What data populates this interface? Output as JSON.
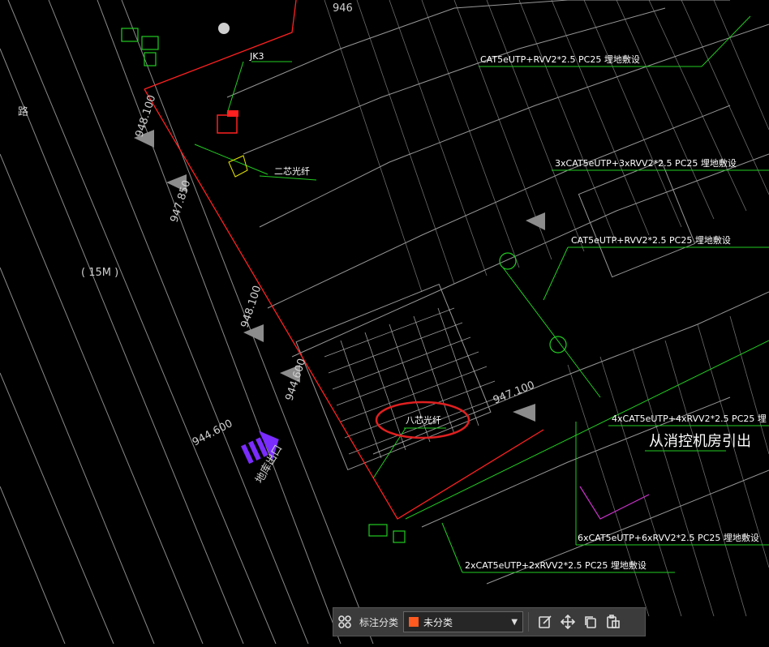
{
  "drawing": {
    "labels": {
      "jk": "JK3",
      "fiber2": "二芯光纤",
      "fiber8": "八芯光纤",
      "cable1": "CAT5eUTP+RVV2*2.5  PC25  埋地敷设",
      "cable2": "3xCAT5eUTP+3xRVV2*2.5  PC25  埋地敷设",
      "cable3": "CAT5eUTP+RVV2*2.5  PC25  埋地敷设",
      "cable4": "4xCAT5eUTP+4xRVV2*2.5  PC25  埋",
      "cable5": "从消控机房引出",
      "cable6": "6xCAT5eUTP+6xRVV2*2.5  PC25  埋地敷设",
      "cable7": "2xCAT5eUTP+2xRVV2*2.5  PC25  埋地敷设",
      "road": "路",
      "width": "( 15M )",
      "elev1": "948.100",
      "elev2": "947.850",
      "elev3": "948.100",
      "elev4": "944.600",
      "elev5": "944.600",
      "elev6": "947.100",
      "exit": "地库出口",
      "elev_top": "946"
    },
    "colors": {
      "background": "#000000",
      "boundary": "#ff2020",
      "cable": "#22cc22",
      "building": "#cfcfcf",
      "highlight": "#e02020",
      "arrow": "#7a2cff"
    }
  },
  "toolbar": {
    "grid_icon": "grid-icon",
    "category_label": "标注分类",
    "category_value": "未分类",
    "category_color": "#ff5a1f",
    "edit_icon": "edit-icon",
    "move_icon": "move-icon",
    "copy_icon": "copy-icon",
    "paste_icon": "paste-icon"
  }
}
